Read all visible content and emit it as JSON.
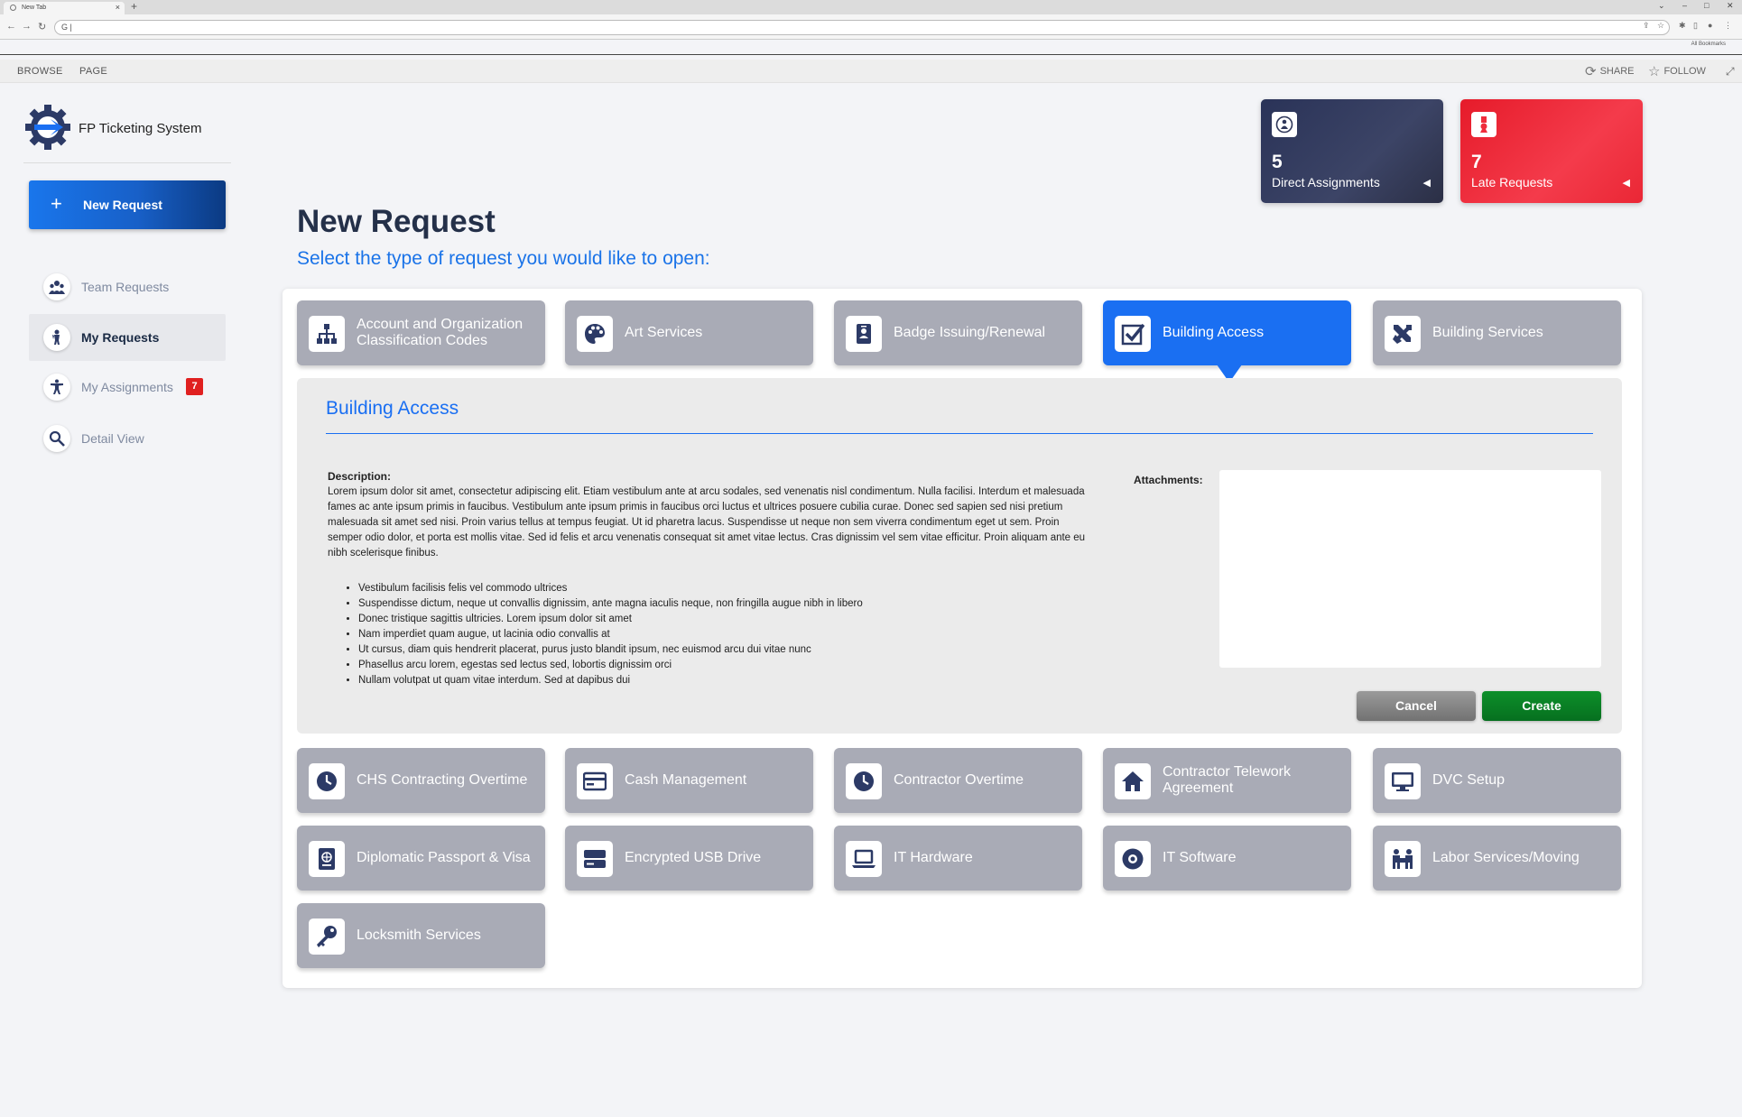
{
  "browser": {
    "tab_title": "New Tab",
    "tab_close": "×",
    "new_tab": "+",
    "address": "G |",
    "all_bookmarks": "All Bookmarks",
    "window_controls": [
      "⌄",
      "–",
      "□",
      "✕"
    ]
  },
  "ribbon": {
    "tabs": [
      "BROWSE",
      "PAGE"
    ],
    "share": "SHARE",
    "follow": "FOLLOW"
  },
  "sidebar": {
    "brand": "FP Ticketing System",
    "new_request_label": "New Request",
    "new_request_icon": "+",
    "items": [
      {
        "label": "Team Requests",
        "icon": "team-icon"
      },
      {
        "label": "My Requests",
        "icon": "person-icon",
        "active": true
      },
      {
        "label": "My Assignments",
        "icon": "accessibility-icon",
        "badge": "7"
      },
      {
        "label": "Detail View",
        "icon": "magnifier-icon"
      }
    ]
  },
  "kpis": [
    {
      "value": "5",
      "label": "Direct Assignments",
      "arrow": "◀",
      "color": "#2f375a"
    },
    {
      "value": "7",
      "label": "Late Requests",
      "arrow": "◀",
      "color": "#ef2d3c"
    }
  ],
  "page": {
    "title": "New Request",
    "subtitle": "Select the type of request you would like to open:"
  },
  "request_types_top": [
    {
      "label": "Account and Organization Classification Codes",
      "icon": "org-chart-icon"
    },
    {
      "label": "Art Services",
      "icon": "palette-icon"
    },
    {
      "label": "Badge Issuing/Renewal",
      "icon": "badge-icon"
    },
    {
      "label": "Building Access",
      "icon": "checkmark-icon",
      "selected": true
    },
    {
      "label": "Building Services",
      "icon": "tools-icon"
    }
  ],
  "detail": {
    "title": "Building Access",
    "description_label": "Description:",
    "description": "Lorem ipsum dolor sit amet, consectetur adipiscing elit. Etiam vestibulum ante at arcu sodales, sed venenatis nisl condimentum. Nulla facilisi. Interdum et malesuada fames ac ante ipsum primis in faucibus. Vestibulum ante ipsum primis in faucibus orci luctus et ultrices posuere cubilia curae. Donec sed sapien sed nisi pretium malesuada sit amet sed nisi. Proin varius tellus at tempus feugiat. Ut id pharetra lacus. Suspendisse ut neque non sem viverra condimentum eget ut sem. Proin semper odio dolor, et porta est mollis vitae. Sed id felis et arcu venenatis consequat sit amet vitae lectus. Cras dignissim vel sem vitae efficitur. Proin aliquam ante eu nibh scelerisque finibus.",
    "bullets": [
      "Vestibulum facilisis felis vel commodo ultrices",
      "Suspendisse dictum, neque ut convallis dignissim, ante magna iaculis neque, non fringilla augue nibh in libero",
      "Donec tristique sagittis ultricies. Lorem ipsum dolor sit amet",
      "Nam imperdiet quam augue, ut lacinia odio convallis at",
      "Ut cursus, diam quis hendrerit placerat, purus justo blandit ipsum, nec euismod arcu dui vitae nunc",
      "Phasellus arcu lorem, egestas sed lectus sed, lobortis dignissim orci",
      "Nullam volutpat ut quam vitae interdum. Sed at dapibus dui"
    ],
    "attachments_label": "Attachments:",
    "cancel_label": "Cancel",
    "create_label": "Create"
  },
  "request_types_bottom": [
    {
      "label": "CHS Contracting Overtime",
      "icon": "clock-icon"
    },
    {
      "label": "Cash Management",
      "icon": "card-icon"
    },
    {
      "label": "Contractor Overtime",
      "icon": "clock-icon"
    },
    {
      "label": "Contractor Telework Agreement",
      "icon": "home-icon"
    },
    {
      "label": "DVC Setup",
      "icon": "monitor-icon"
    },
    {
      "label": "Diplomatic Passport & Visa",
      "icon": "passport-icon"
    },
    {
      "label": "Encrypted USB Drive",
      "icon": "drive-icon"
    },
    {
      "label": "IT Hardware",
      "icon": "laptop-icon"
    },
    {
      "label": "IT Software",
      "icon": "disc-icon"
    },
    {
      "label": "Labor Services/Moving",
      "icon": "people-icon"
    },
    {
      "label": "Locksmith Services",
      "icon": "key-icon"
    }
  ]
}
